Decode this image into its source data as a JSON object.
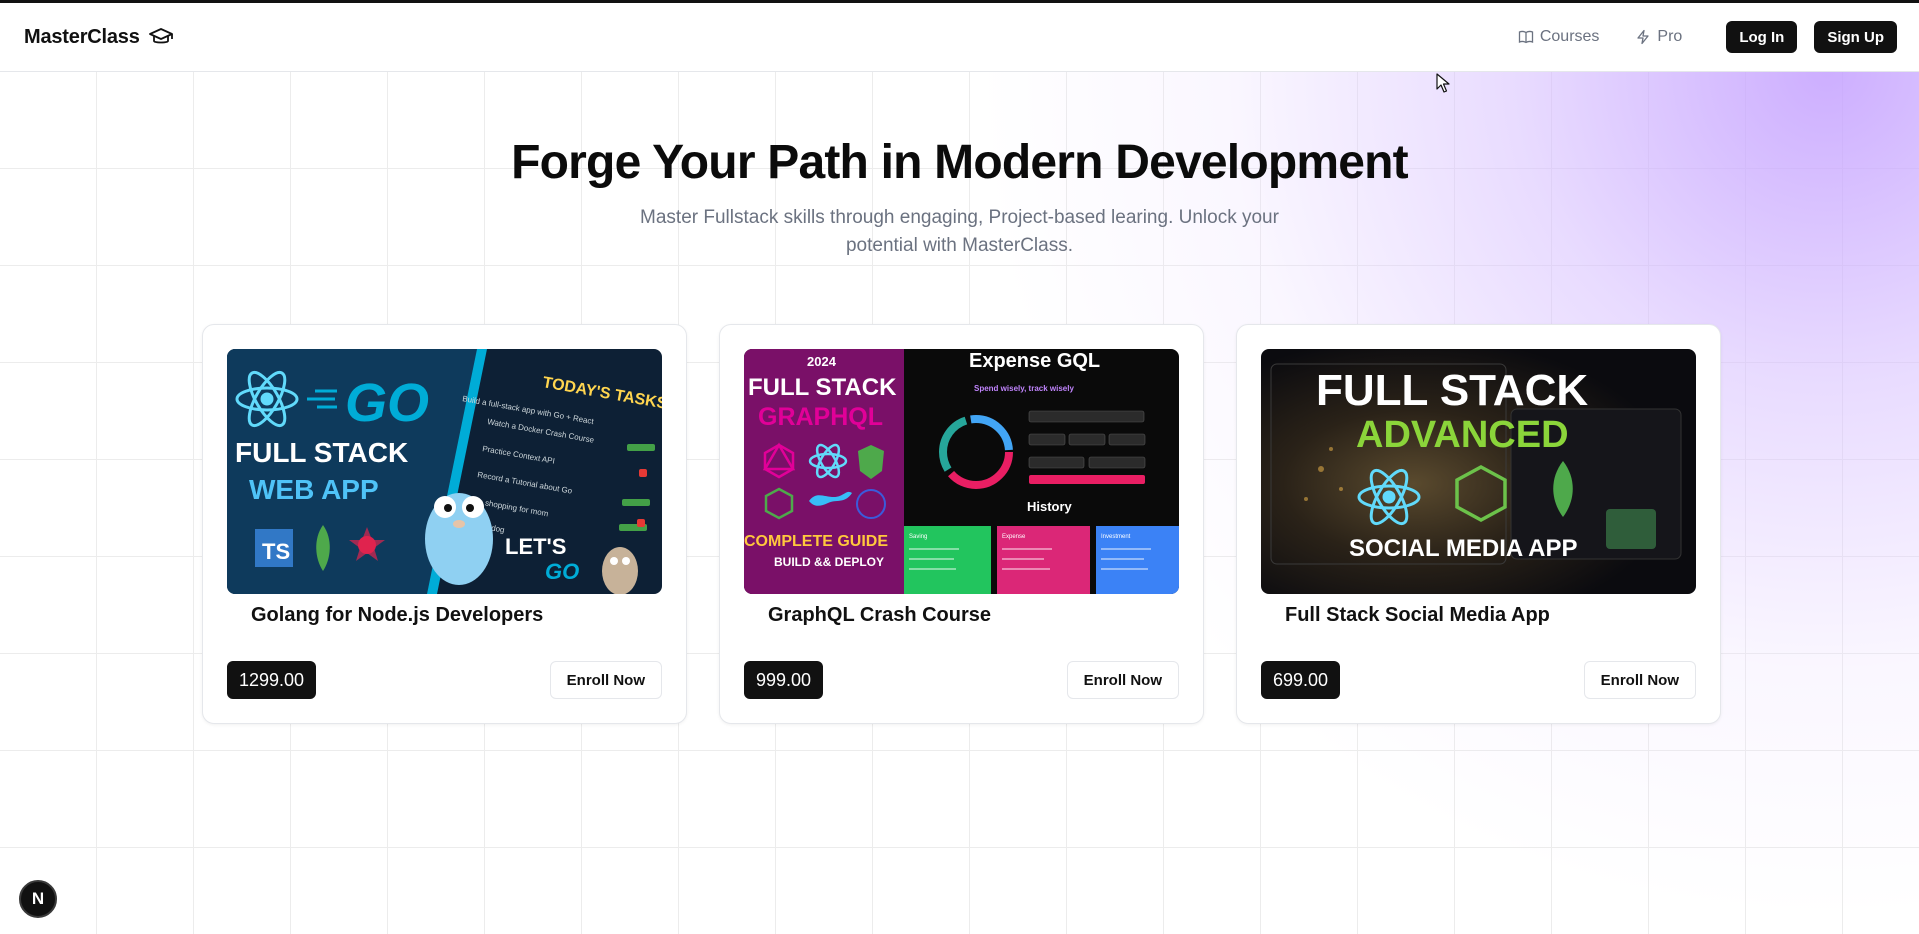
{
  "header": {
    "brand": "MasterClass",
    "brand_icon": "graduation-cap-icon",
    "nav": [
      {
        "label": "Courses",
        "icon": "book-open-icon"
      },
      {
        "label": "Pro",
        "icon": "zap-icon"
      }
    ],
    "login_label": "Log In",
    "signup_label": "Sign Up"
  },
  "hero": {
    "title": "Forge Your Path in Modern Development",
    "subtitle": "Master Fullstack skills through engaging, Project-based learing. Unlock your potential with MasterClass."
  },
  "courses": [
    {
      "title": "Golang for Node.js Developers",
      "price": "1299.00",
      "enroll_label": "Enroll Now",
      "thumb": {
        "line1": "GO",
        "line2": "FULL STACK",
        "line3": "WEB APP",
        "panel": "TODAY'S TASKS",
        "badge_ts": "TS",
        "cta": "LET'S",
        "cta2": "GO",
        "tasks": [
          "Build a full-stack app with Go + React",
          "Watch a Docker Crash Course",
          "Practice Context API",
          "Record a Tutorial about Go",
          "Go shopping for mom",
          "Take dog"
        ]
      }
    },
    {
      "title": "GraphQL Crash Course",
      "price": "999.00",
      "enroll_label": "Enroll Now",
      "thumb": {
        "year": "2024",
        "line1": "FULL STACK",
        "line2": "GRAPHQL",
        "guide": "COMPLETE GUIDE",
        "deploy": "BUILD && DEPLOY",
        "app_title": "Expense GQL",
        "app_sub": "Spend wisely, track wisely",
        "history": "History",
        "cat1": "Saving",
        "cat2": "Expense",
        "cat3": "Investment"
      }
    },
    {
      "title": "Full Stack Social Media App",
      "price": "699.00",
      "enroll_label": "Enroll Now",
      "thumb": {
        "line1": "FULL STACK",
        "line2": "ADVANCED",
        "line3": "SOCIAL MEDIA APP"
      }
    }
  ],
  "dev_badge": "N",
  "colors": {
    "dark": "#111111",
    "muted": "#6b7280",
    "glow": "#c4a0ff",
    "go_blue": "#00acd7",
    "graphql_pink": "#e10098",
    "mongo_green": "#4ea94b"
  }
}
